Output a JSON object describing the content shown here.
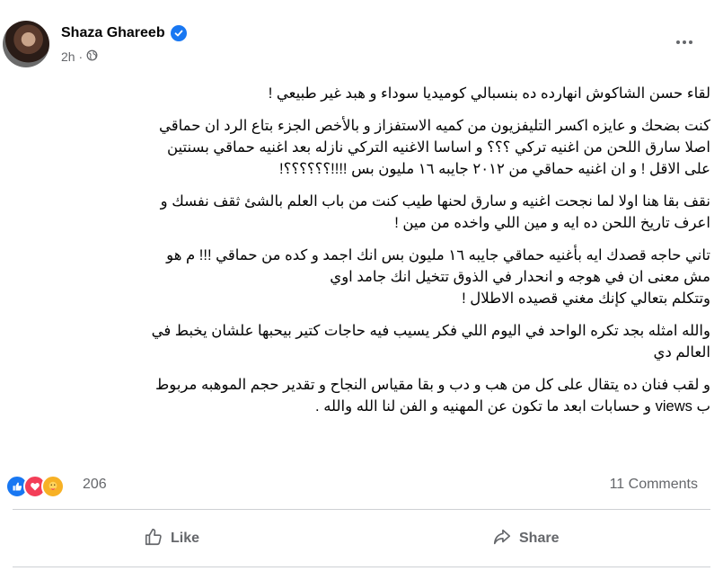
{
  "post": {
    "author": "Shaza Ghareeb",
    "time": "2h ·",
    "body_lines": [
      [
        "لقاء حسن الشاكوش انهارده ده بنسبالي كوميديا سوداء   و هبد غير طبيعي !"
      ],
      [
        "كنت بضحك و عايزه اكسر التليفزيون من كميه الاستفزاز و بالأخص الجزء بتاع الرد ان حماقي",
        "اصلا سارق اللحن من اغنيه تركي ؟؟؟ و اساسا الاغنيه التركي نازله بعد اغنيه حماقي  بسنتين",
        "على الاقل ! و ان اغنيه حماقي من ٢٠١٢ جايبه ١٦ مليون بس !!!!؟؟؟؟؟؟!"
      ],
      [
        "نقف بقا هنا اولا  لما نجحت اغنيه و سارق لحنها طيب كنت من باب العلم بالشئ ثقف نفسك و",
        "اعرف تاريخ اللحن ده ايه و مين اللي واخده من مين !"
      ],
      [
        "تاني حاجه قصدك ايه بأغنيه حماقي جايبه ١٦ مليون بس انك اجمد و كده من حماقي !!! م هو",
        "مش معنى ان في هوجه  و انحدار في الذوق  تتخيل انك جامد اوي",
        "وتتكلم بتعالي كإنك مغني  قصيده الاطلال !"
      ],
      [
        "والله امثله بجد تكره الواحد في اليوم اللي فكر يسيب فيه حاجات كتير بيحبها علشان يخبط في",
        "العالم  دي"
      ],
      [
        "و لقب فنان ده يتقال على كل من هب و دب و بقا مقياس النجاح و تقدير حجم الموهبه مربوط",
        "ب views و حسابات ابعد ما تكون عن  المهنيه و الفن لنا الله والله ."
      ]
    ],
    "reaction_count": "206",
    "comments_count": "11 Comments",
    "like_label": "Like",
    "share_label": "Share"
  },
  "icons": {
    "verified": "verified-badge-icon",
    "privacy": "globe-icon",
    "more": "more-options-icon",
    "reactions": [
      "like-reaction-icon",
      "love-reaction-icon",
      "care-reaction-icon"
    ],
    "like": "thumbs-up-icon",
    "share": "share-arrow-icon"
  },
  "colors": {
    "brand_blue": "#1877f2",
    "love_red": "#f33e58",
    "care_yellow": "#f7b125",
    "secondary_text": "#65676b",
    "divider": "#ced0d4"
  }
}
